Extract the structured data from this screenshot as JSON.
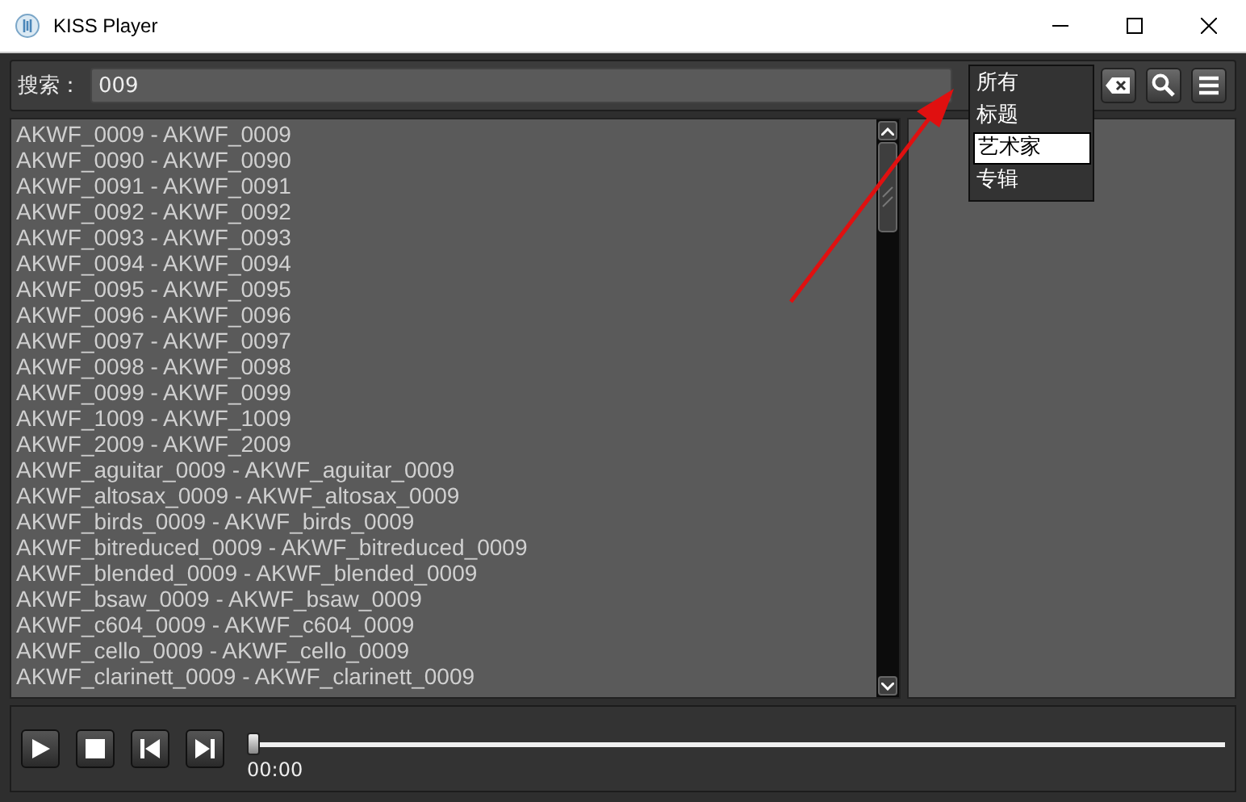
{
  "window": {
    "title": "KISS Player"
  },
  "search": {
    "label": "搜索：",
    "value": "009"
  },
  "filter_dropdown": {
    "options": [
      {
        "label": "所有",
        "selected": false
      },
      {
        "label": "标题",
        "selected": false
      },
      {
        "label": "艺术家",
        "selected": true
      },
      {
        "label": "专辑",
        "selected": false
      }
    ]
  },
  "results": [
    "AKWF_0009 - AKWF_0009",
    "AKWF_0090 - AKWF_0090",
    "AKWF_0091 - AKWF_0091",
    "AKWF_0092 - AKWF_0092",
    "AKWF_0093 - AKWF_0093",
    "AKWF_0094 - AKWF_0094",
    "AKWF_0095 - AKWF_0095",
    "AKWF_0096 - AKWF_0096",
    "AKWF_0097 - AKWF_0097",
    "AKWF_0098 - AKWF_0098",
    "AKWF_0099 - AKWF_0099",
    "AKWF_1009 - AKWF_1009",
    "AKWF_2009 - AKWF_2009",
    "AKWF_aguitar_0009 - AKWF_aguitar_0009",
    "AKWF_altosax_0009 - AKWF_altosax_0009",
    "AKWF_birds_0009 - AKWF_birds_0009",
    "AKWF_bitreduced_0009 - AKWF_bitreduced_0009",
    "AKWF_blended_0009 - AKWF_blended_0009",
    "AKWF_bsaw_0009 - AKWF_bsaw_0009",
    "AKWF_c604_0009 - AKWF_c604_0009",
    "AKWF_cello_0009 - AKWF_cello_0009",
    "AKWF_clarinett_0009 - AKWF_clarinett_0009"
  ],
  "player": {
    "position": {
      "level": 0
    },
    "time": "00:00"
  }
}
